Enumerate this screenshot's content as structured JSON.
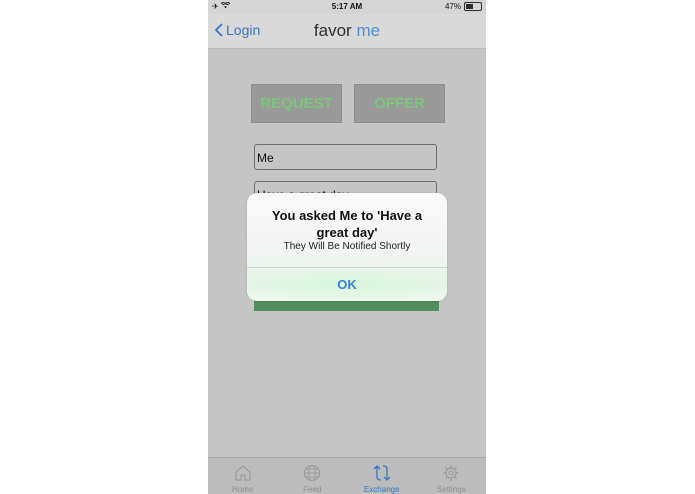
{
  "status_bar": {
    "carrier_icon": "airplane-icon",
    "wifi_icon": "wifi-icon",
    "time": "5:17 AM",
    "battery_text": "47%",
    "battery_level": 0.47
  },
  "nav": {
    "back_label": "Login",
    "title_main": "favor",
    "title_accent": " me"
  },
  "segments": {
    "request_label": "REQUEST",
    "offer_label": "OFFER"
  },
  "form": {
    "to_value": "Me",
    "favor_value": "Have a great day"
  },
  "tabs": [
    {
      "label": "Home",
      "icon": "home-icon"
    },
    {
      "label": "Feed",
      "icon": "globe-icon"
    },
    {
      "label": "Exchange",
      "icon": "exchange-icon"
    },
    {
      "label": "Settings",
      "icon": "gear-icon"
    }
  ],
  "alert": {
    "title": "You asked Me to 'Have a great day'",
    "message": "They Will Be Notified Shortly",
    "ok_label": "OK"
  },
  "colors": {
    "accent": "#3a7fd3",
    "segment_text": "#88d688",
    "submit_bar": "#5a9a68"
  }
}
